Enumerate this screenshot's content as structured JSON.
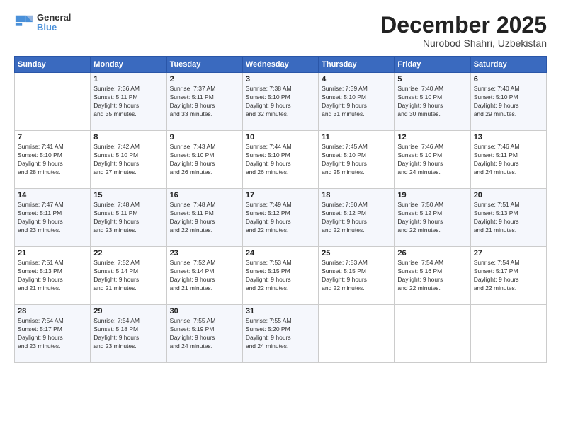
{
  "logo": {
    "line1": "General",
    "line2": "Blue"
  },
  "header": {
    "month": "December 2025",
    "location": "Nurobod Shahri, Uzbekistan"
  },
  "weekdays": [
    "Sunday",
    "Monday",
    "Tuesday",
    "Wednesday",
    "Thursday",
    "Friday",
    "Saturday"
  ],
  "weeks": [
    [
      {
        "day": "",
        "info": ""
      },
      {
        "day": "1",
        "info": "Sunrise: 7:36 AM\nSunset: 5:11 PM\nDaylight: 9 hours\nand 35 minutes."
      },
      {
        "day": "2",
        "info": "Sunrise: 7:37 AM\nSunset: 5:11 PM\nDaylight: 9 hours\nand 33 minutes."
      },
      {
        "day": "3",
        "info": "Sunrise: 7:38 AM\nSunset: 5:10 PM\nDaylight: 9 hours\nand 32 minutes."
      },
      {
        "day": "4",
        "info": "Sunrise: 7:39 AM\nSunset: 5:10 PM\nDaylight: 9 hours\nand 31 minutes."
      },
      {
        "day": "5",
        "info": "Sunrise: 7:40 AM\nSunset: 5:10 PM\nDaylight: 9 hours\nand 30 minutes."
      },
      {
        "day": "6",
        "info": "Sunrise: 7:40 AM\nSunset: 5:10 PM\nDaylight: 9 hours\nand 29 minutes."
      }
    ],
    [
      {
        "day": "7",
        "info": "Sunrise: 7:41 AM\nSunset: 5:10 PM\nDaylight: 9 hours\nand 28 minutes."
      },
      {
        "day": "8",
        "info": "Sunrise: 7:42 AM\nSunset: 5:10 PM\nDaylight: 9 hours\nand 27 minutes."
      },
      {
        "day": "9",
        "info": "Sunrise: 7:43 AM\nSunset: 5:10 PM\nDaylight: 9 hours\nand 26 minutes."
      },
      {
        "day": "10",
        "info": "Sunrise: 7:44 AM\nSunset: 5:10 PM\nDaylight: 9 hours\nand 26 minutes."
      },
      {
        "day": "11",
        "info": "Sunrise: 7:45 AM\nSunset: 5:10 PM\nDaylight: 9 hours\nand 25 minutes."
      },
      {
        "day": "12",
        "info": "Sunrise: 7:46 AM\nSunset: 5:10 PM\nDaylight: 9 hours\nand 24 minutes."
      },
      {
        "day": "13",
        "info": "Sunrise: 7:46 AM\nSunset: 5:11 PM\nDaylight: 9 hours\nand 24 minutes."
      }
    ],
    [
      {
        "day": "14",
        "info": "Sunrise: 7:47 AM\nSunset: 5:11 PM\nDaylight: 9 hours\nand 23 minutes."
      },
      {
        "day": "15",
        "info": "Sunrise: 7:48 AM\nSunset: 5:11 PM\nDaylight: 9 hours\nand 23 minutes."
      },
      {
        "day": "16",
        "info": "Sunrise: 7:48 AM\nSunset: 5:11 PM\nDaylight: 9 hours\nand 22 minutes."
      },
      {
        "day": "17",
        "info": "Sunrise: 7:49 AM\nSunset: 5:12 PM\nDaylight: 9 hours\nand 22 minutes."
      },
      {
        "day": "18",
        "info": "Sunrise: 7:50 AM\nSunset: 5:12 PM\nDaylight: 9 hours\nand 22 minutes."
      },
      {
        "day": "19",
        "info": "Sunrise: 7:50 AM\nSunset: 5:12 PM\nDaylight: 9 hours\nand 22 minutes."
      },
      {
        "day": "20",
        "info": "Sunrise: 7:51 AM\nSunset: 5:13 PM\nDaylight: 9 hours\nand 21 minutes."
      }
    ],
    [
      {
        "day": "21",
        "info": "Sunrise: 7:51 AM\nSunset: 5:13 PM\nDaylight: 9 hours\nand 21 minutes."
      },
      {
        "day": "22",
        "info": "Sunrise: 7:52 AM\nSunset: 5:14 PM\nDaylight: 9 hours\nand 21 minutes."
      },
      {
        "day": "23",
        "info": "Sunrise: 7:52 AM\nSunset: 5:14 PM\nDaylight: 9 hours\nand 21 minutes."
      },
      {
        "day": "24",
        "info": "Sunrise: 7:53 AM\nSunset: 5:15 PM\nDaylight: 9 hours\nand 22 minutes."
      },
      {
        "day": "25",
        "info": "Sunrise: 7:53 AM\nSunset: 5:15 PM\nDaylight: 9 hours\nand 22 minutes."
      },
      {
        "day": "26",
        "info": "Sunrise: 7:54 AM\nSunset: 5:16 PM\nDaylight: 9 hours\nand 22 minutes."
      },
      {
        "day": "27",
        "info": "Sunrise: 7:54 AM\nSunset: 5:17 PM\nDaylight: 9 hours\nand 22 minutes."
      }
    ],
    [
      {
        "day": "28",
        "info": "Sunrise: 7:54 AM\nSunset: 5:17 PM\nDaylight: 9 hours\nand 23 minutes."
      },
      {
        "day": "29",
        "info": "Sunrise: 7:54 AM\nSunset: 5:18 PM\nDaylight: 9 hours\nand 23 minutes."
      },
      {
        "day": "30",
        "info": "Sunrise: 7:55 AM\nSunset: 5:19 PM\nDaylight: 9 hours\nand 24 minutes."
      },
      {
        "day": "31",
        "info": "Sunrise: 7:55 AM\nSunset: 5:20 PM\nDaylight: 9 hours\nand 24 minutes."
      },
      {
        "day": "",
        "info": ""
      },
      {
        "day": "",
        "info": ""
      },
      {
        "day": "",
        "info": ""
      }
    ]
  ]
}
